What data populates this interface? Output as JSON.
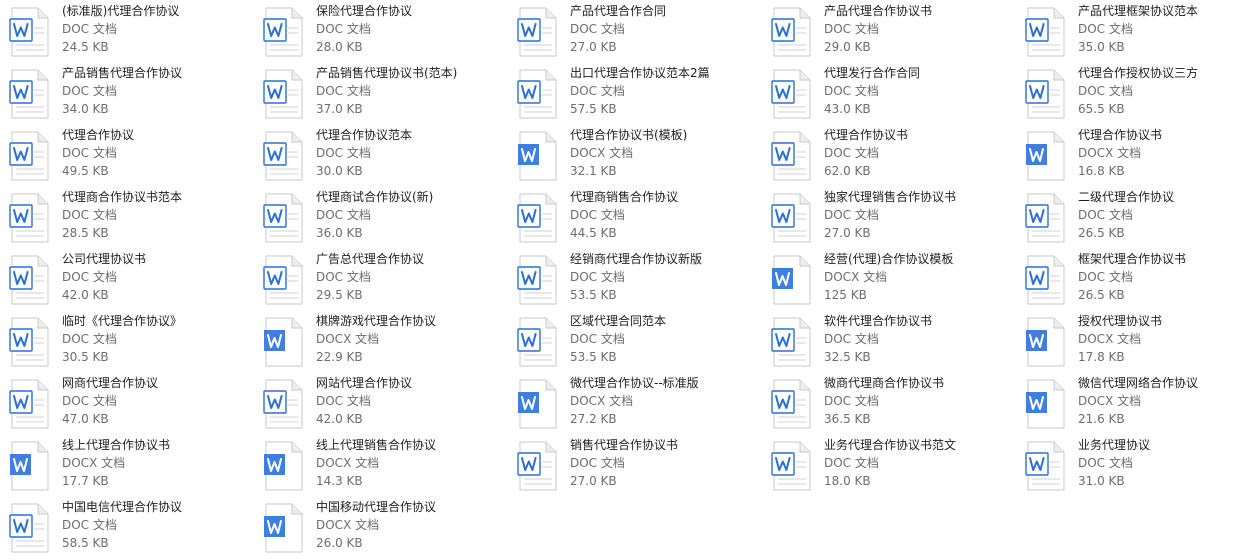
{
  "colors": {
    "doc_icon": "#2b6fd6",
    "docx_icon": "#3f7fe0",
    "name_text": "#1f1f1f",
    "meta_text": "#6d6d6d"
  },
  "files": [
    {
      "name": "(标准版)代理合作协议",
      "type": "DOC 文档",
      "size": "24.5 KB",
      "icon": "doc-icon"
    },
    {
      "name": "保险代理合作协议",
      "type": "DOC 文档",
      "size": "28.0 KB",
      "icon": "doc-icon"
    },
    {
      "name": "产品代理合作合同",
      "type": "DOC 文档",
      "size": "27.0 KB",
      "icon": "doc-icon"
    },
    {
      "name": "产品代理合作协议书",
      "type": "DOC 文档",
      "size": "29.0 KB",
      "icon": "doc-icon"
    },
    {
      "name": "产品代理框架协议范本",
      "type": "DOC 文档",
      "size": "35.0 KB",
      "icon": "doc-icon"
    },
    {
      "name": "产品销售代理合作协议",
      "type": "DOC 文档",
      "size": "34.0 KB",
      "icon": "doc-icon"
    },
    {
      "name": "产品销售代理协议书(范本)",
      "type": "DOC 文档",
      "size": "37.0 KB",
      "icon": "doc-icon"
    },
    {
      "name": "出口代理合作协议范本2篇",
      "type": "DOC 文档",
      "size": "57.5 KB",
      "icon": "doc-icon"
    },
    {
      "name": "代理发行合作合同",
      "type": "DOC 文档",
      "size": "43.0 KB",
      "icon": "doc-icon"
    },
    {
      "name": "代理合作授权协议三方",
      "type": "DOC 文档",
      "size": "65.5 KB",
      "icon": "doc-icon"
    },
    {
      "name": "代理合作协议",
      "type": "DOC 文档",
      "size": "49.5 KB",
      "icon": "doc-icon"
    },
    {
      "name": "代理合作协议范本",
      "type": "DOC 文档",
      "size": "30.0 KB",
      "icon": "doc-icon"
    },
    {
      "name": "代理合作协议书(模板)",
      "type": "DOCX 文档",
      "size": "32.1 KB",
      "icon": "docx-icon"
    },
    {
      "name": "代理合作协议书",
      "type": "DOC 文档",
      "size": "62.0 KB",
      "icon": "doc-icon"
    },
    {
      "name": "代理合作协议书",
      "type": "DOCX 文档",
      "size": "16.8 KB",
      "icon": "docx-icon"
    },
    {
      "name": "代理商合作协议书范本",
      "type": "DOC 文档",
      "size": "28.5 KB",
      "icon": "doc-icon"
    },
    {
      "name": "代理商试合作协议(新)",
      "type": "DOC 文档",
      "size": "36.0 KB",
      "icon": "doc-icon"
    },
    {
      "name": "代理商销售合作协议",
      "type": "DOC 文档",
      "size": "44.5 KB",
      "icon": "doc-icon"
    },
    {
      "name": "独家代理销售合作协议书",
      "type": "DOC 文档",
      "size": "27.0 KB",
      "icon": "doc-icon"
    },
    {
      "name": "二级代理合作协议",
      "type": "DOC 文档",
      "size": "26.5 KB",
      "icon": "doc-icon"
    },
    {
      "name": "公司代理协议书",
      "type": "DOC 文档",
      "size": "42.0 KB",
      "icon": "doc-icon"
    },
    {
      "name": "广告总代理合作协议",
      "type": "DOC 文档",
      "size": "29.5 KB",
      "icon": "doc-icon"
    },
    {
      "name": "经销商代理合作协议新版",
      "type": "DOC 文档",
      "size": "53.5 KB",
      "icon": "doc-icon"
    },
    {
      "name": "经营(代理)合作协议模板",
      "type": "DOCX 文档",
      "size": "125 KB",
      "icon": "docx-icon"
    },
    {
      "name": "框架代理合作协议书",
      "type": "DOC 文档",
      "size": "26.5 KB",
      "icon": "doc-icon"
    },
    {
      "name": "临时《代理合作协议》",
      "type": "DOC 文档",
      "size": "30.5 KB",
      "icon": "doc-icon"
    },
    {
      "name": "棋牌游戏代理合作协议",
      "type": "DOCX 文档",
      "size": "22.9 KB",
      "icon": "docx-icon"
    },
    {
      "name": "区域代理合同范本",
      "type": "DOC 文档",
      "size": "53.5 KB",
      "icon": "doc-icon"
    },
    {
      "name": "软件代理合作协议书",
      "type": "DOC 文档",
      "size": "32.5 KB",
      "icon": "doc-icon"
    },
    {
      "name": "授权代理协议书",
      "type": "DOCX 文档",
      "size": "17.8 KB",
      "icon": "docx-icon"
    },
    {
      "name": "网商代理合作协议",
      "type": "DOC 文档",
      "size": "47.0 KB",
      "icon": "doc-icon"
    },
    {
      "name": "网站代理合作协议",
      "type": "DOC 文档",
      "size": "42.0 KB",
      "icon": "doc-icon"
    },
    {
      "name": "微代理合作协议--标准版",
      "type": "DOCX 文档",
      "size": "27.2 KB",
      "icon": "docx-icon"
    },
    {
      "name": "微商代理商合作协议书",
      "type": "DOC 文档",
      "size": "36.5 KB",
      "icon": "doc-icon"
    },
    {
      "name": "微信代理网络合作协议",
      "type": "DOCX 文档",
      "size": "21.6 KB",
      "icon": "docx-icon"
    },
    {
      "name": "线上代理合作协议书",
      "type": "DOCX 文档",
      "size": "17.7 KB",
      "icon": "docx-icon"
    },
    {
      "name": "线上代理销售合作协议",
      "type": "DOCX 文档",
      "size": "14.3 KB",
      "icon": "docx-icon"
    },
    {
      "name": "销售代理合作协议书",
      "type": "DOC 文档",
      "size": "27.0 KB",
      "icon": "doc-icon"
    },
    {
      "name": "业务代理合作协议书范文",
      "type": "DOC 文档",
      "size": "18.0 KB",
      "icon": "doc-icon"
    },
    {
      "name": "业务代理协议",
      "type": "DOC 文档",
      "size": "31.0 KB",
      "icon": "doc-icon"
    },
    {
      "name": "中国电信代理合作协议",
      "type": "DOC 文档",
      "size": "58.5 KB",
      "icon": "doc-icon"
    },
    {
      "name": "中国移动代理合作协议",
      "type": "DOCX 文档",
      "size": "26.0 KB",
      "icon": "docx-icon"
    }
  ]
}
